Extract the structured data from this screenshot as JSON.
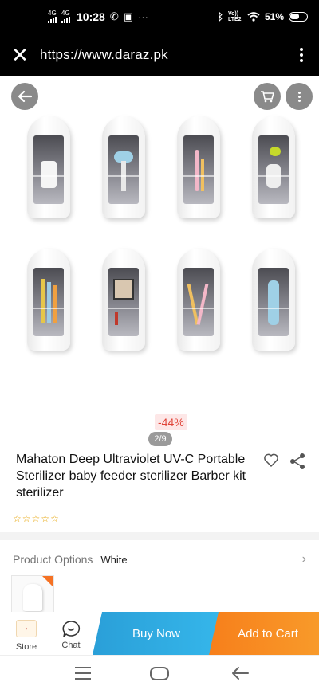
{
  "status_bar": {
    "network_left_1": "4G",
    "network_left_2": "4G",
    "time": "10:28",
    "volte": "Vo)) LTE2",
    "battery": "51%"
  },
  "browser": {
    "url": "https://www.daraz.pk",
    "close_icon": "close-icon",
    "menu_icon": "kebab-menu-icon"
  },
  "gallery": {
    "page_indicator": "2/9",
    "images_shown": 8
  },
  "product": {
    "discount": "-44%",
    "title": "Mahaton Deep Ultraviolet UV-C Portable Sterilizer baby feeder sterilizer Barber kit sterilizer",
    "rating_stars": 0,
    "rating_out_of": 5
  },
  "options": {
    "label": "Product Options",
    "value": "White"
  },
  "actions": {
    "store_label": "Store",
    "chat_label": "Chat",
    "buy_now": "Buy Now",
    "add_to_cart": "Add to Cart"
  },
  "colors": {
    "buy_now": "#2a9fd8",
    "add_to_cart": "#f77f1b",
    "discount": "#e0453a",
    "star": "#e6a200"
  }
}
